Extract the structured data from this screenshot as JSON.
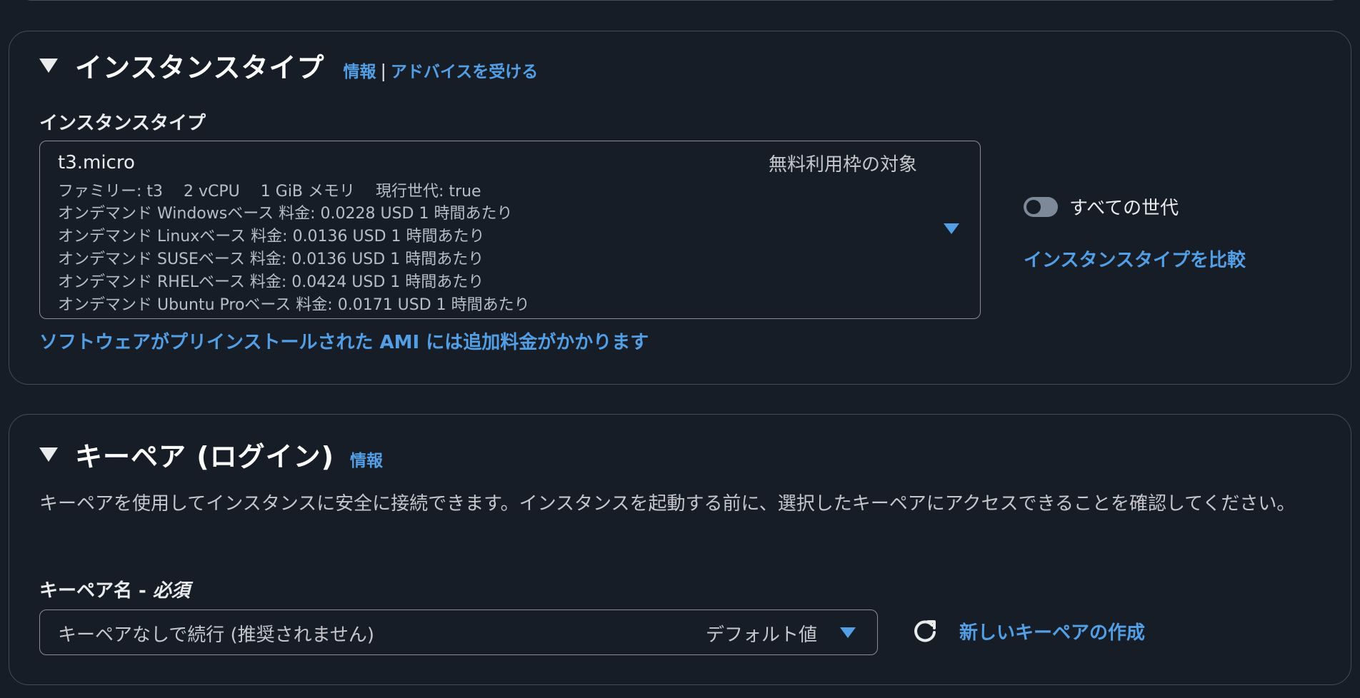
{
  "instance_section": {
    "title": "インスタンスタイプ",
    "info_link": "情報",
    "separator": "|",
    "advice_link": "アドバイスを受ける",
    "field_label": "インスタンスタイプ",
    "selected": {
      "name": "t3.micro",
      "free_tier": "無料利用枠の対象",
      "family": "ファミリー: t3",
      "vcpu": "2 vCPU",
      "memory": "1 GiB メモリ",
      "current_gen": "現行世代: true",
      "prices": [
        "オンデマンド Windowsベース 料金: 0.0228 USD 1 時間あたり",
        "オンデマンド Linuxベース 料金: 0.0136 USD 1 時間あたり",
        "オンデマンド SUSEベース 料金: 0.0136 USD 1 時間あたり",
        "オンデマンド RHELベース 料金: 0.0424 USD 1 時間あたり",
        "オンデマンド Ubuntu Proベース 料金: 0.0171 USD 1 時間あたり"
      ]
    },
    "ami_link": "ソフトウェアがプリインストールされた AMI には追加料金がかかります",
    "toggle_label": "すべての世代",
    "compare_link": "インスタンスタイプを比較"
  },
  "keypair_section": {
    "title": "キーペア (ログイン)",
    "info_link": "情報",
    "description": "キーペアを使用してインスタンスに安全に接続できます。インスタンスを起動する前に、選択したキーペアにアクセスできることを確認してください。",
    "field_label": "キーペア名 - ",
    "required": "必須",
    "selected_value": "キーペアなしで続行 (推奨されません)",
    "default_tag": "デフォルト値",
    "new_link": "新しいキーペアの作成"
  },
  "colors": {
    "background": "#161d26",
    "link": "#539fe5",
    "border": "#414d5c"
  }
}
